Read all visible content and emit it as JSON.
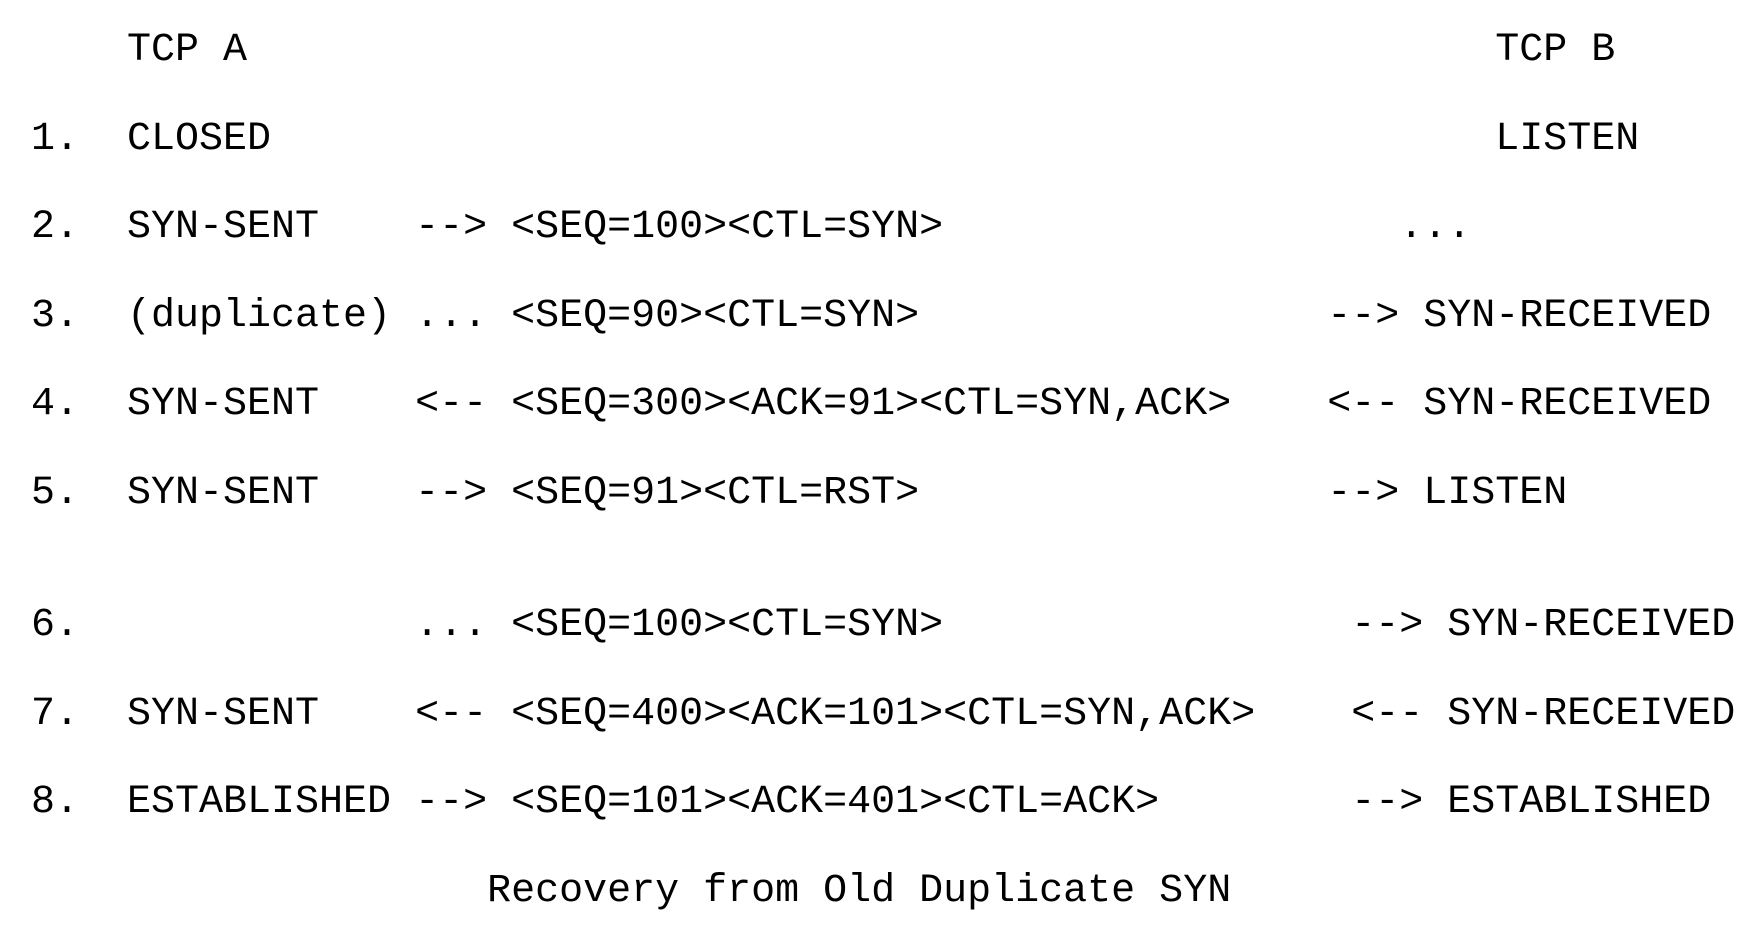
{
  "header": "    TCP A                                                    TCP B",
  "steps": [
    "1.  CLOSED                                                   LISTEN",
    "2.  SYN-SENT    --> <SEQ=100><CTL=SYN>                   ...",
    "3.  (duplicate) ... <SEQ=90><CTL=SYN>                 --> SYN-RECEIVED",
    "4.  SYN-SENT    <-- <SEQ=300><ACK=91><CTL=SYN,ACK>    <-- SYN-RECEIVED",
    "5.  SYN-SENT    --> <SEQ=91><CTL=RST>                 --> LISTEN",
    "6.              ... <SEQ=100><CTL=SYN>                 --> SYN-RECEIVED",
    "7.  SYN-SENT    <-- <SEQ=400><ACK=101><CTL=SYN,ACK>    <-- SYN-RECEIVED",
    "8.  ESTABLISHED --> <SEQ=101><ACK=401><CTL=ACK>        --> ESTABLISHED"
  ],
  "caption": "                   Recovery from Old Duplicate SYN"
}
